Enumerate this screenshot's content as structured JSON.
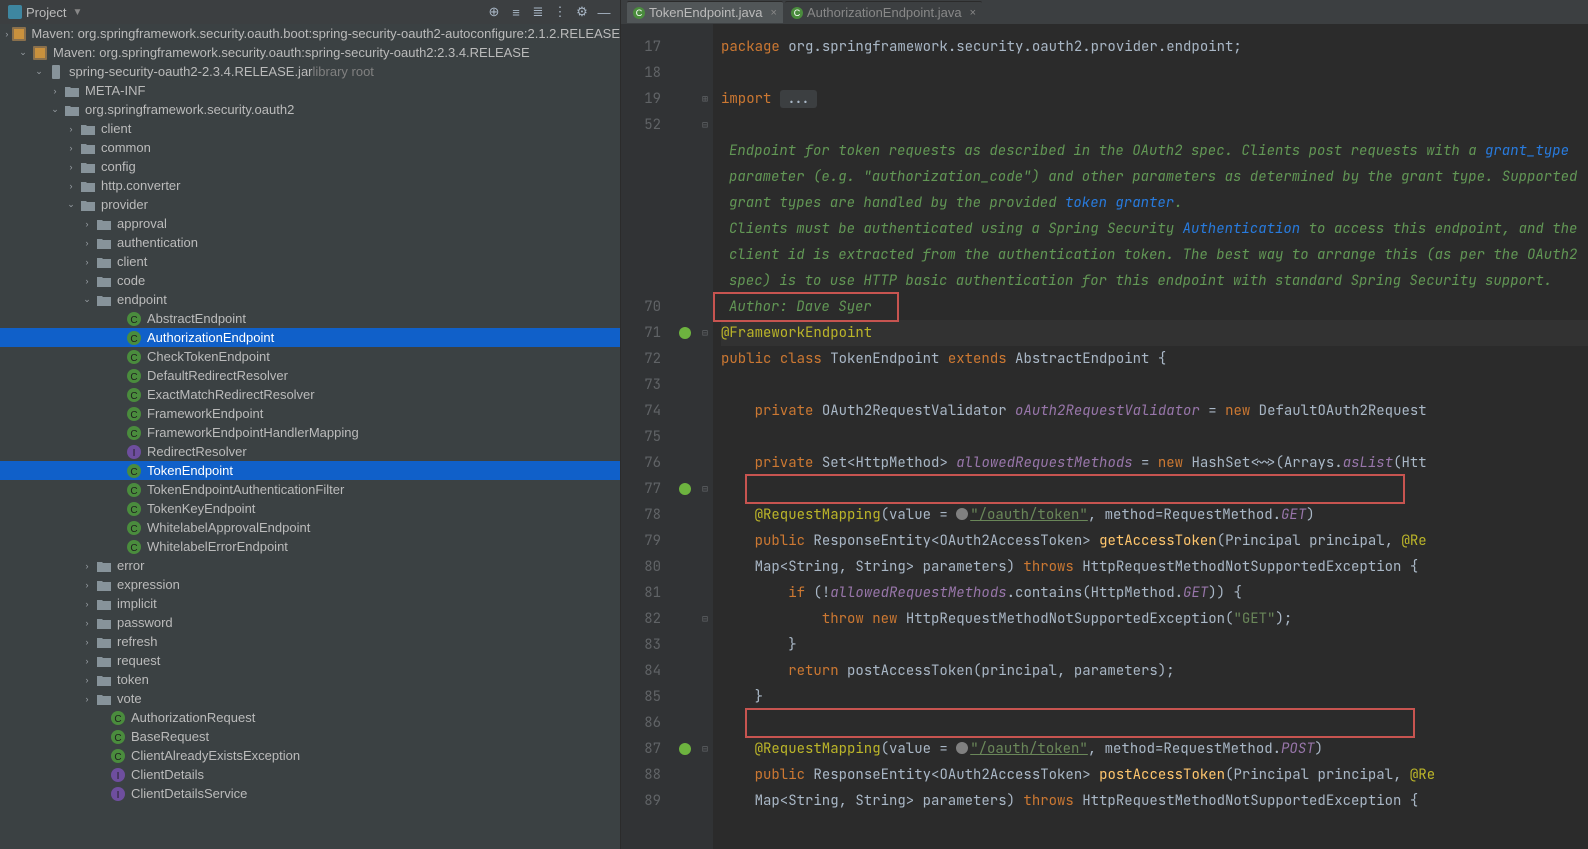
{
  "projectHeader": {
    "title": "Project"
  },
  "toolbarIcons": [
    "target",
    "expand",
    "collapse",
    "divider",
    "gear",
    "hide"
  ],
  "tabs": [
    {
      "name": "TokenEndpoint.java",
      "active": true
    },
    {
      "name": "AuthorizationEndpoint.java",
      "active": false
    }
  ],
  "tree": [
    {
      "indent": 18,
      "chev": ">",
      "icon": "lib",
      "text": "Maven: org.springframework.security.oauth.boot:spring-security-oauth2-autoconfigure:2.1.2.RELEASE"
    },
    {
      "indent": 18,
      "chev": "v",
      "icon": "lib",
      "text": "Maven: org.springframework.security.oauth:spring-security-oauth2:2.3.4.RELEASE"
    },
    {
      "indent": 34,
      "chev": "v",
      "icon": "jar",
      "text": "spring-security-oauth2-2.3.4.RELEASE.jar",
      "suffix": "library root"
    },
    {
      "indent": 50,
      "chev": ">",
      "icon": "folder",
      "text": "META-INF"
    },
    {
      "indent": 50,
      "chev": "v",
      "icon": "folder",
      "text": "org.springframework.security.oauth2"
    },
    {
      "indent": 66,
      "chev": ">",
      "icon": "folder",
      "text": "client"
    },
    {
      "indent": 66,
      "chev": ">",
      "icon": "folder",
      "text": "common"
    },
    {
      "indent": 66,
      "chev": ">",
      "icon": "folder",
      "text": "config"
    },
    {
      "indent": 66,
      "chev": ">",
      "icon": "folder",
      "text": "http.converter"
    },
    {
      "indent": 66,
      "chev": "v",
      "icon": "folder",
      "text": "provider"
    },
    {
      "indent": 82,
      "chev": ">",
      "icon": "folder",
      "text": "approval"
    },
    {
      "indent": 82,
      "chev": ">",
      "icon": "folder",
      "text": "authentication"
    },
    {
      "indent": 82,
      "chev": ">",
      "icon": "folder",
      "text": "client"
    },
    {
      "indent": 82,
      "chev": ">",
      "icon": "folder",
      "text": "code"
    },
    {
      "indent": 82,
      "chev": "v",
      "icon": "folder",
      "text": "endpoint"
    },
    {
      "indent": 112,
      "icon": "class",
      "text": "AbstractEndpoint"
    },
    {
      "indent": 112,
      "icon": "class",
      "text": "AuthorizationEndpoint",
      "selected": true
    },
    {
      "indent": 112,
      "icon": "class",
      "text": "CheckTokenEndpoint"
    },
    {
      "indent": 112,
      "icon": "class",
      "text": "DefaultRedirectResolver"
    },
    {
      "indent": 112,
      "icon": "class",
      "text": "ExactMatchRedirectResolver"
    },
    {
      "indent": 112,
      "icon": "class",
      "text": "FrameworkEndpoint"
    },
    {
      "indent": 112,
      "icon": "class",
      "text": "FrameworkEndpointHandlerMapping"
    },
    {
      "indent": 112,
      "icon": "iface",
      "text": "RedirectResolver"
    },
    {
      "indent": 112,
      "icon": "class",
      "text": "TokenEndpoint",
      "selected": true
    },
    {
      "indent": 112,
      "icon": "class",
      "text": "TokenEndpointAuthenticationFilter"
    },
    {
      "indent": 112,
      "icon": "class",
      "text": "TokenKeyEndpoint"
    },
    {
      "indent": 112,
      "icon": "class",
      "text": "WhitelabelApprovalEndpoint"
    },
    {
      "indent": 112,
      "icon": "class",
      "text": "WhitelabelErrorEndpoint"
    },
    {
      "indent": 82,
      "chev": ">",
      "icon": "folder",
      "text": "error"
    },
    {
      "indent": 82,
      "chev": ">",
      "icon": "folder",
      "text": "expression"
    },
    {
      "indent": 82,
      "chev": ">",
      "icon": "folder",
      "text": "implicit"
    },
    {
      "indent": 82,
      "chev": ">",
      "icon": "folder",
      "text": "password"
    },
    {
      "indent": 82,
      "chev": ">",
      "icon": "folder",
      "text": "refresh"
    },
    {
      "indent": 82,
      "chev": ">",
      "icon": "folder",
      "text": "request"
    },
    {
      "indent": 82,
      "chev": ">",
      "icon": "folder",
      "text": "token"
    },
    {
      "indent": 82,
      "chev": ">",
      "icon": "folder",
      "text": "vote"
    },
    {
      "indent": 96,
      "icon": "class",
      "text": "AuthorizationRequest"
    },
    {
      "indent": 96,
      "icon": "class",
      "text": "BaseRequest"
    },
    {
      "indent": 96,
      "icon": "class",
      "text": "ClientAlreadyExistsException"
    },
    {
      "indent": 96,
      "icon": "iface",
      "text": "ClientDetails"
    },
    {
      "indent": 96,
      "icon": "iface",
      "text": "ClientDetailsService"
    }
  ],
  "gutterLines": [
    "17",
    "18",
    "19",
    "52",
    "",
    "",
    "",
    "",
    "",
    "",
    "70",
    "71",
    "72",
    "73",
    "74",
    "75",
    "76",
    "77",
    "78",
    "79",
    "80",
    "81",
    "82",
    "83",
    "84",
    "85",
    "86",
    "87",
    "88",
    "89"
  ],
  "marks": {
    "11": "spring",
    "17": "spring",
    "27": "spring"
  },
  "folds": {
    "2": "+",
    "3": "-",
    "11": "-",
    "17": "-",
    "22": "-",
    "27": "-"
  },
  "doc": {
    "l1a": "Endpoint for token requests as described in the OAuth2 spec. Clients post requests with a ",
    "l1b": "grant_type",
    "l2": "parameter (e.g. \"authorization_code\") and other parameters as determined by the grant type. Supported",
    "l3a": "grant types are handled by the provided ",
    "l3b": "token",
    "l3c": " ",
    "l3d": "granter",
    "l4a": "Clients must be authenticated using a Spring Security ",
    "l4b": "Authentication",
    "l4c": " to access this endpoint, and the",
    "l5": "client id is extracted from the authentication token. The best way to arrange this (as per the OAuth2",
    "l6": "spec) is to use HTTP basic authentication for this endpoint with standard Spring Security support.",
    "author": "Author: Dave Syer"
  },
  "code": {
    "pkg": "package",
    "pkgPath": "org.springframework.security.oauth2.provider.endpoint",
    "imp": "import",
    "fold": "...",
    "annFramework": "@FrameworkEndpoint",
    "pub": "public",
    "cls": "class",
    "clsName": "TokenEndpoint",
    "ext": "extends",
    "parentCls": "AbstractEndpoint",
    "priv": "private",
    "type1": "OAuth2RequestValidator",
    "field1": "oAuth2RequestValidator",
    "neww": "new",
    "ctor1": "DefaultOAuth2Request",
    "typeSet": "Set",
    "typeHttpMethod": "HttpMethod",
    "field2": "allowedRequestMethods",
    "ctorHash": "HashSet",
    "diamond": "<~>",
    "arrAsList": "Arrays.",
    "asList": "asList",
    "htt": "(Htt",
    "annReq": "@RequestMapping",
    "valueEq": "(value = ",
    "oauthToken": "\"/oauth/token\"",
    "methodEq": ", method=RequestMethod.",
    "GET": "GET",
    "POST": "POST",
    "respEnt": "ResponseEntity",
    "oauth2Tok": "OAuth2AccessToken",
    "getAccessToken": "getAccessToken",
    "postAccessToken": "postAccessToken",
    "principal": "Principal principal",
    "atRe": "@Re",
    "mapArg": "Map<String, String> parameters)",
    "throws": "throws",
    "exc": "HttpRequestMethodNotSupportedException",
    "ifKw": "if",
    "bang": "(!",
    "contains": ".contains(",
    "getLit": "GET",
    "throwKw": "throw",
    "excCtor": "HttpRequestMethodNotSupportedException",
    "getStr": "\"GET\"",
    "ret": "return",
    "postCall": "postAccessToken(principal, parameters)"
  }
}
